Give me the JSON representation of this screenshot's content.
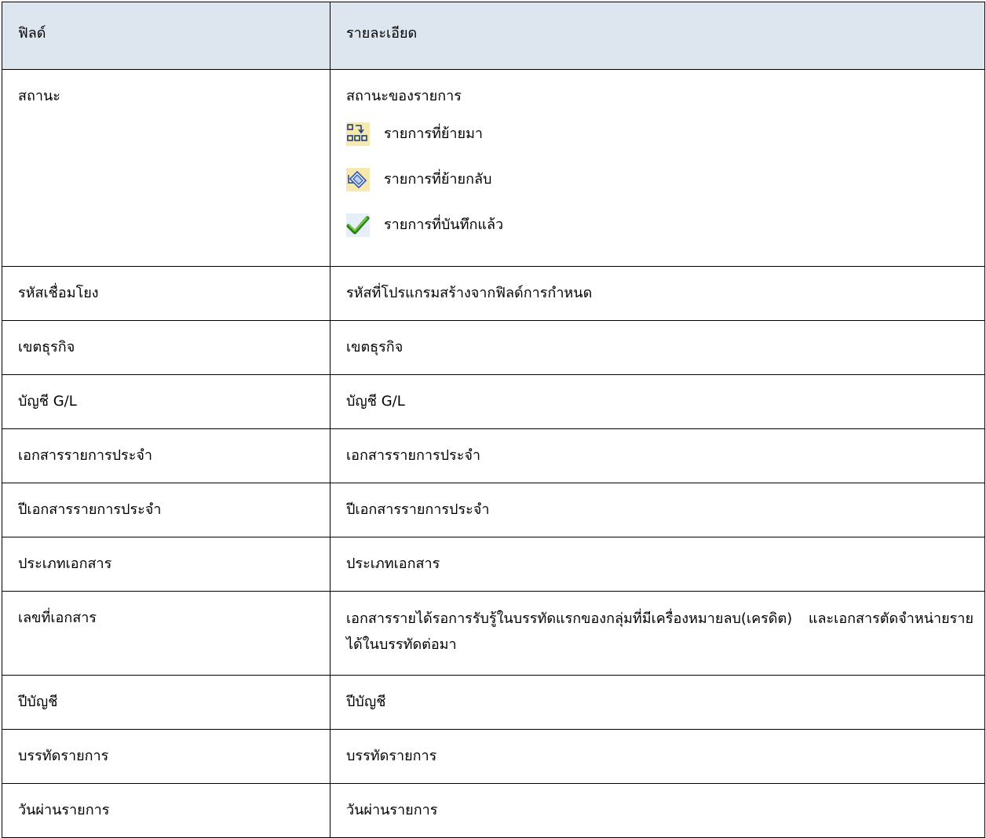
{
  "table": {
    "header": {
      "field": "ฟิลด์",
      "description": "รายละเอียด"
    },
    "status": {
      "field": "สถานะ",
      "description": "สถานะของรายการ",
      "items": [
        {
          "icon": "transfer-in-icon",
          "label": "รายการที่ย้ายมา"
        },
        {
          "icon": "transfer-back-icon",
          "label": "รายการที่ย้ายกลับ"
        },
        {
          "icon": "checkmark-icon",
          "label": "รายการที่บันทึกแล้ว"
        }
      ]
    },
    "rows": [
      {
        "field": "รหัสเชื่อมโยง",
        "description": "รหัสที่โปรแกรมสร้างจากฟิลด์การกำหนด"
      },
      {
        "field": "เขตธุรกิจ",
        "description": "เขตธุรกิจ"
      },
      {
        "field": "บัญชี G/L",
        "description": "บัญชี G/L"
      },
      {
        "field": "เอกสารรายการประจำ",
        "description": "เอกสารรายการประจำ"
      },
      {
        "field": "ปีเอกสารรายการประจำ",
        "description": "ปีเอกสารรายการประจำ"
      },
      {
        "field": "ประเภทเอกสาร",
        "description": "ประเภทเอกสาร"
      },
      {
        "field": "เลขที่เอกสาร",
        "description": "เอกสารรายได้รอการรับรู้ในบรรทัดแรกของกลุ่มที่มีเครื่องหมายลบ(เครดิต) และเอกสารตัดจำหน่ายรายได้ในบรรทัดต่อมา"
      },
      {
        "field": "ปีบัญชี",
        "description": "ปีบัญชี"
      },
      {
        "field": "บรรทัดรายการ",
        "description": "บรรทัดรายการ"
      },
      {
        "field": "วันผ่านรายการ",
        "description": "วันผ่านรายการ"
      }
    ]
  },
  "colors": {
    "header_background": "#dde5ef",
    "border": "#000000",
    "check_green": "#3a9a1e",
    "icon_background": "#f5e9b0"
  }
}
